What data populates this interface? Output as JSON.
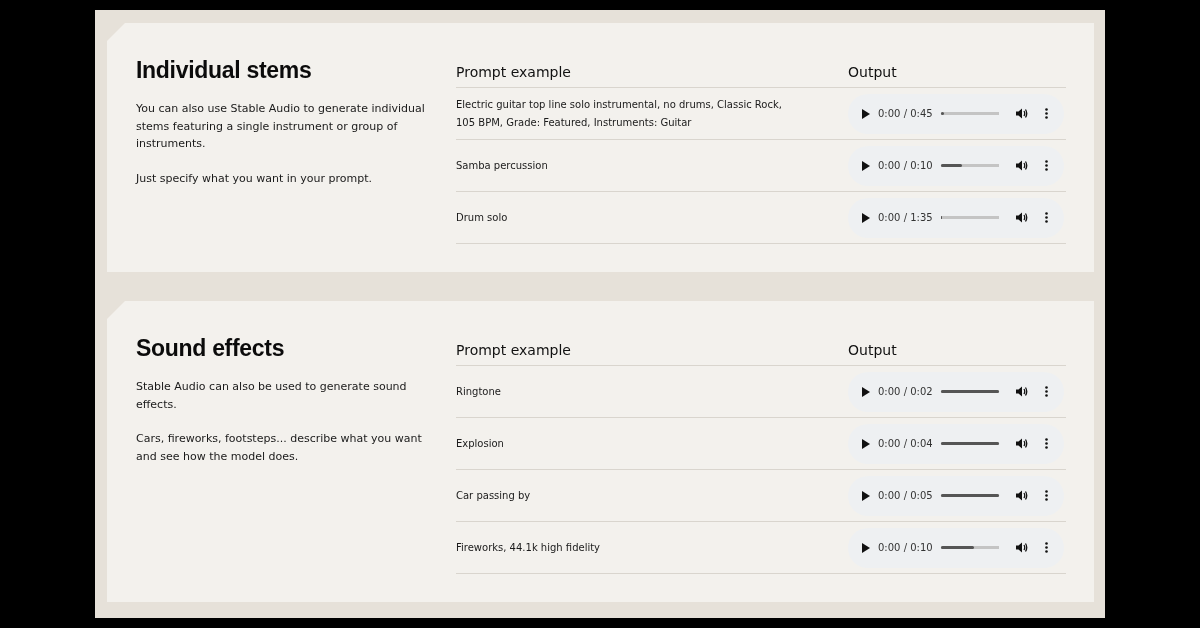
{
  "sections": [
    {
      "title": "Individual stems",
      "paragraphs": [
        "You can also use Stable Audio to generate individual stems featuring a single instrument or group of instruments.",
        "Just specify what you want in your prompt."
      ],
      "columns": [
        "Prompt example",
        "Output"
      ],
      "rows": [
        {
          "prompt": "Electric guitar top line solo instrumental, no drums, Classic Rock, 105 BPM, Grade: Featured, Instruments: Guitar",
          "time": "0:00 / 0:45",
          "level": 0.05
        },
        {
          "prompt": "Samba percussion",
          "time": "0:00 / 0:10",
          "level": 0.37
        },
        {
          "prompt": "Drum solo",
          "time": "0:00 / 1:35",
          "level": 0.02
        }
      ]
    },
    {
      "title": "Sound effects",
      "paragraphs": [
        "Stable Audio can also be used to generate sound effects.",
        "Cars, fireworks, footsteps... describe what you want and see how the model does."
      ],
      "columns": [
        "Prompt example",
        "Output"
      ],
      "rows": [
        {
          "prompt": "Ringtone",
          "time": "0:00 / 0:02",
          "level": 1
        },
        {
          "prompt": "Explosion",
          "time": "0:00 / 0:04",
          "level": 1
        },
        {
          "prompt": "Car passing by",
          "time": "0:00 / 0:05",
          "level": 1
        },
        {
          "prompt": "Fireworks, 44.1k high fidelity",
          "time": "0:00 / 0:10",
          "level": 0.57
        }
      ]
    }
  ]
}
